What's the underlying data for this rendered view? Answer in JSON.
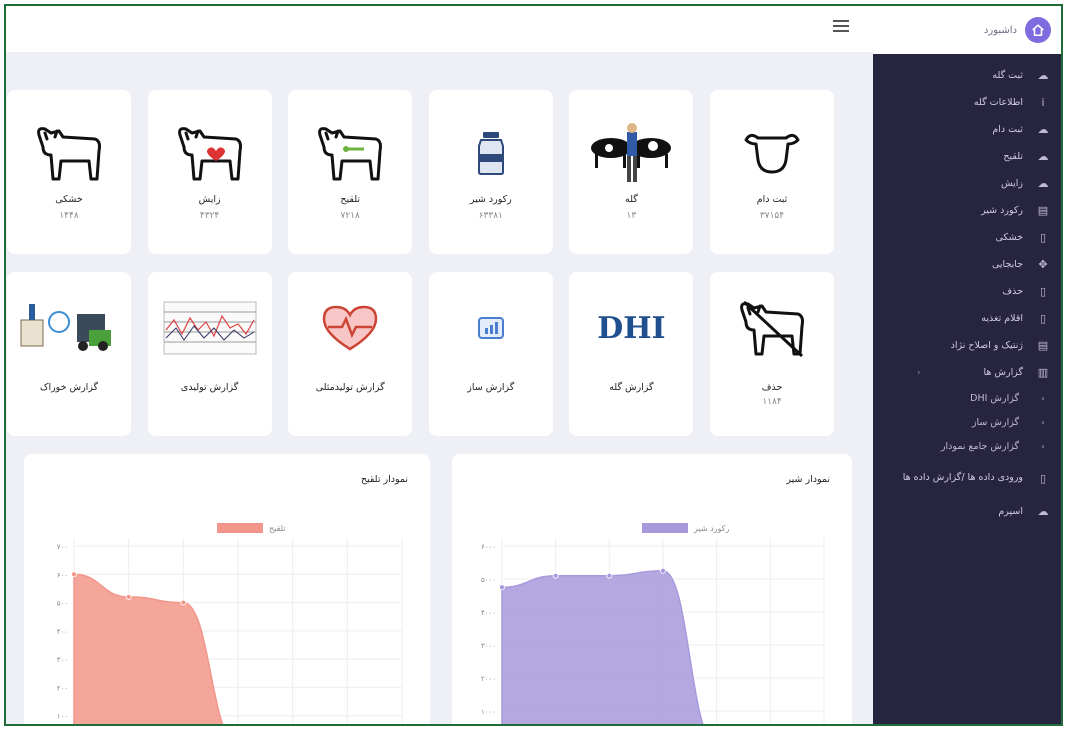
{
  "sidebar": {
    "title": "داشبورد",
    "items": [
      {
        "label": "ثبت گله",
        "icon": "cloud-icon"
      },
      {
        "label": "اطلاعات گله",
        "icon": "info-icon"
      },
      {
        "label": "ثبت دام",
        "icon": "cloud-icon"
      },
      {
        "label": "تلقیح",
        "icon": "cloud-icon"
      },
      {
        "label": "زایش",
        "icon": "cloud-icon"
      },
      {
        "label": "رکورد شیر",
        "icon": "form-icon"
      },
      {
        "label": "خشکی",
        "icon": "doc-icon"
      },
      {
        "label": "جابجایی",
        "icon": "move-icon"
      },
      {
        "label": "حذف",
        "icon": "doc-icon"
      },
      {
        "label": "اقلام تغذیه",
        "icon": "doc-icon"
      },
      {
        "label": "ژنتیک و اصلاح نژاد",
        "icon": "form-icon"
      },
      {
        "label": "گزارش ها",
        "icon": "columns-icon"
      }
    ],
    "sub_items": [
      "گزارش DHI",
      "گزارش ساز",
      "گزارش جامع نمودار"
    ],
    "extra_items": [
      {
        "label": "ورودی داده ها /گزارش داده ها",
        "icon": "doc-icon"
      },
      {
        "label": "اسپرم",
        "icon": "cloud-icon"
      }
    ]
  },
  "stat_cards": [
    {
      "name": "ثبت دام",
      "value": "۳۷۱۵۴",
      "icon": "cow-head-icon"
    },
    {
      "name": "گله",
      "value": "۱۳",
      "icon": "herd-icon"
    },
    {
      "name": "رکورد شیر",
      "value": "۶۳۳۸۱",
      "icon": "milk-bottle-icon"
    },
    {
      "name": "تلقیح",
      "value": "۷۲۱۸",
      "icon": "cow-syringe-icon"
    },
    {
      "name": "زایش",
      "value": "۴۳۲۴",
      "icon": "cow-heart-icon"
    },
    {
      "name": "خشکی",
      "value": "۱۴۴۸",
      "icon": "cow-icon"
    }
  ],
  "report_cards": [
    {
      "name": "حذف",
      "value": "۱۱۸۴",
      "icon": "cow-crossed-icon"
    },
    {
      "name": "گزارش گله",
      "value": "",
      "icon": "dhi-logo",
      "logo_text": "DHI"
    },
    {
      "name": "گزارش ساز",
      "value": "",
      "icon": "report-builder-icon"
    },
    {
      "name": "گزارش تولیدمثلی",
      "value": "",
      "icon": "heart-pulse-icon"
    },
    {
      "name": "گزارش تولیدی",
      "value": "",
      "icon": "table-report-icon"
    },
    {
      "name": "گزارش خوراک",
      "value": "",
      "icon": "feed-icon"
    }
  ],
  "charts": [
    {
      "title": "نمودار شیر",
      "chart_data": {
        "type": "area",
        "legend": "رکورد شیر",
        "color": "#a899dc",
        "y_ticks": [
          "۶۰۰۰",
          "۵۰۰۰",
          "۴۰۰۰",
          "۳۰۰۰",
          "۲۰۰۰",
          "۱۰۰۰"
        ],
        "ylim": [
          0,
          6000
        ],
        "values": [
          4750,
          5100,
          5100,
          5250,
          0,
          0
        ]
      }
    },
    {
      "title": "نمودار تلقیح",
      "chart_data": {
        "type": "area",
        "legend": "تلقیح",
        "color": "#f2968a",
        "y_ticks": [
          "۷۰۰",
          "۶۰۰",
          "۵۰۰",
          "۴۰۰",
          "۳۰۰",
          "۲۰۰",
          "۱۰۰"
        ],
        "ylim": [
          0,
          700
        ],
        "values": [
          600,
          520,
          500,
          0,
          0,
          0
        ]
      }
    }
  ]
}
